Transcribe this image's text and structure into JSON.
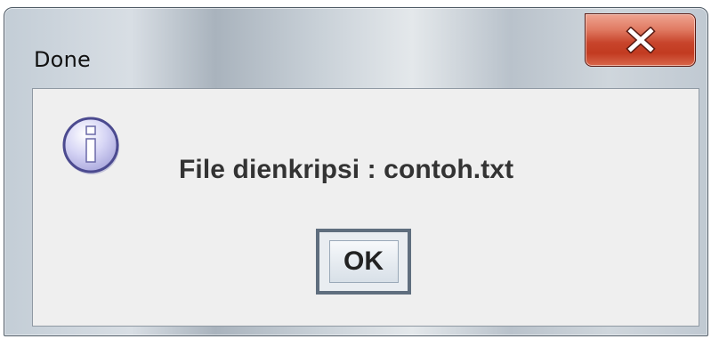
{
  "window": {
    "title": "Done",
    "close_icon": "close-x-icon"
  },
  "dialog": {
    "icon": "info-icon",
    "message": "File dienkripsi : contoh.txt",
    "ok_label": "OK"
  },
  "colors": {
    "close_button": "#c8452c",
    "content_background": "#efefef",
    "info_icon_fill": "#c9c8f0",
    "info_icon_border": "#4b4a8f"
  }
}
